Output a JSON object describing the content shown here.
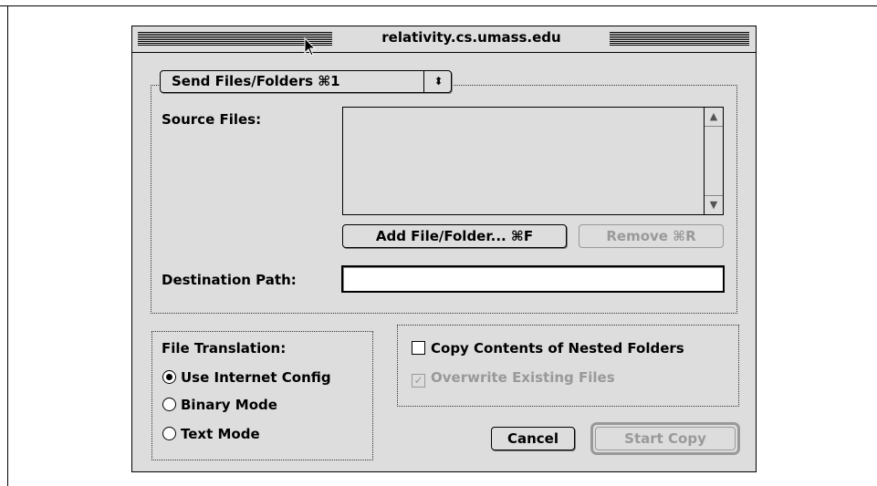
{
  "window": {
    "title": "relativity.cs.umass.edu"
  },
  "mode_popup": {
    "label": "Send Files/Folders ⌘1",
    "arrows": "⬍"
  },
  "source": {
    "label": "Source Files:",
    "scroll_up": "▲",
    "scroll_down": "▼"
  },
  "buttons": {
    "add": "Add File/Folder... ⌘F",
    "remove": "Remove ⌘R",
    "cancel": "Cancel",
    "start": "Start Copy"
  },
  "destination": {
    "label": "Destination Path:",
    "value": ""
  },
  "translation": {
    "label": "File Translation:",
    "options": [
      {
        "label": "Use Internet Config",
        "selected": true
      },
      {
        "label": "Binary Mode",
        "selected": false
      },
      {
        "label": "Text Mode",
        "selected": false
      }
    ]
  },
  "options": {
    "copy_nested": {
      "label": "Copy Contents of Nested Folders",
      "checked": false,
      "enabled": true
    },
    "overwrite": {
      "label": "Overwrite Existing Files",
      "checked": true,
      "enabled": false,
      "mark": "✓"
    }
  },
  "colors": {
    "window_bg": "#dddddd",
    "disabled": "#999999"
  }
}
